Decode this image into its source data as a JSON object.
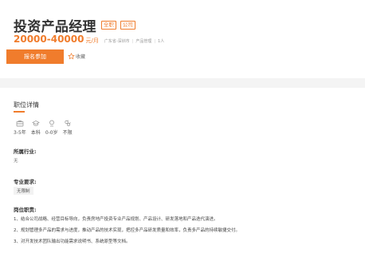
{
  "job": {
    "title": "投资产品经理",
    "tags": [
      "全职",
      "公司"
    ],
    "salary": "20000-40000",
    "salary_unit": "元/月",
    "location": "广东省-深圳市",
    "separator": "|",
    "department": "产品管理",
    "headcount": "1人"
  },
  "actions": {
    "apply_label": "报名参加",
    "collect_label": "收藏"
  },
  "details": {
    "section_title": "职位详情",
    "requirements": [
      {
        "icon": "briefcase-icon",
        "label": "3-5年"
      },
      {
        "icon": "graduation-cap-icon",
        "label": "本科"
      },
      {
        "icon": "person-icon",
        "label": "0-0岁"
      },
      {
        "icon": "gender-icon",
        "label": "不限"
      }
    ],
    "industry_label": "所属行业:",
    "industry_value": "无",
    "major_label": "专业要求:",
    "major_value": "无限制",
    "duties_label": "岗位职责:",
    "duties": [
      "1、结合公司战略、经营目标导向，负责房地产投资专业产品规划、产品设计、研发落地和产品迭代演进。",
      "2、规划管理多产品的需求与进度，推动产品的技术实现，把控多产品研发质量和效率，负责多产品的持续敏捷交付。",
      "3、对开发技术团队输出功能需求说明书、系统原型等文档。"
    ]
  },
  "colors": {
    "accent": "#f07c2c",
    "background": "#f4f4f4"
  }
}
